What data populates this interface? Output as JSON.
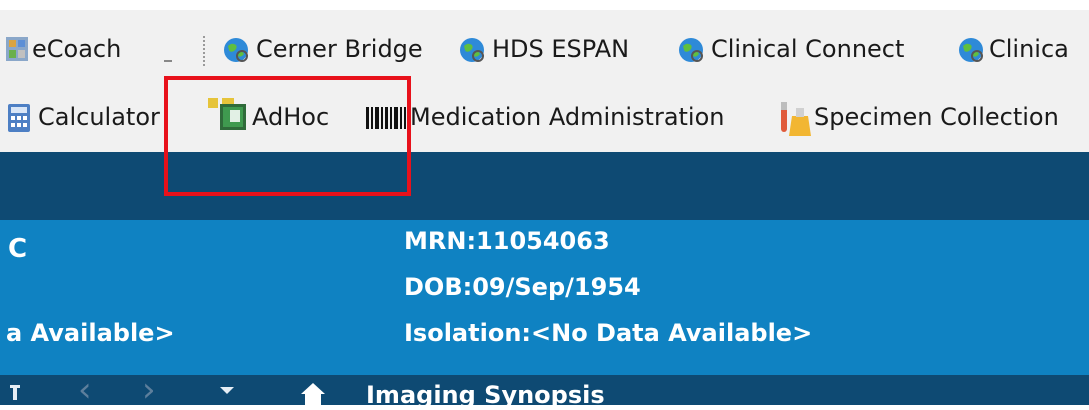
{
  "toolbar_top": {
    "ecoach": "eCoach",
    "cerner_bridge": "Cerner Bridge",
    "hds_espan": "HDS ESPAN",
    "clinical_connect": "Clinical Connect",
    "clinical_cut": "Clinica"
  },
  "toolbar_bottom": {
    "calculator": "Calculator",
    "adhoc": "AdHoc",
    "med_admin": "Medication Administration",
    "specimen": "Specimen Collection"
  },
  "banner": {
    "name_fragment": "C",
    "left_fragment": "a Available>",
    "mrn": "MRN:11054063",
    "dob": "DOB:09/Sep/1954",
    "isolation": "Isolation:<No Data Available>"
  },
  "tabbar": {
    "title": "Imaging Synopsis"
  },
  "colors": {
    "toolbar_bg": "#f1f1f1",
    "nav_dark": "#0e4a73",
    "banner_blue": "#0f82c2",
    "highlight_red": "#e8111b"
  }
}
